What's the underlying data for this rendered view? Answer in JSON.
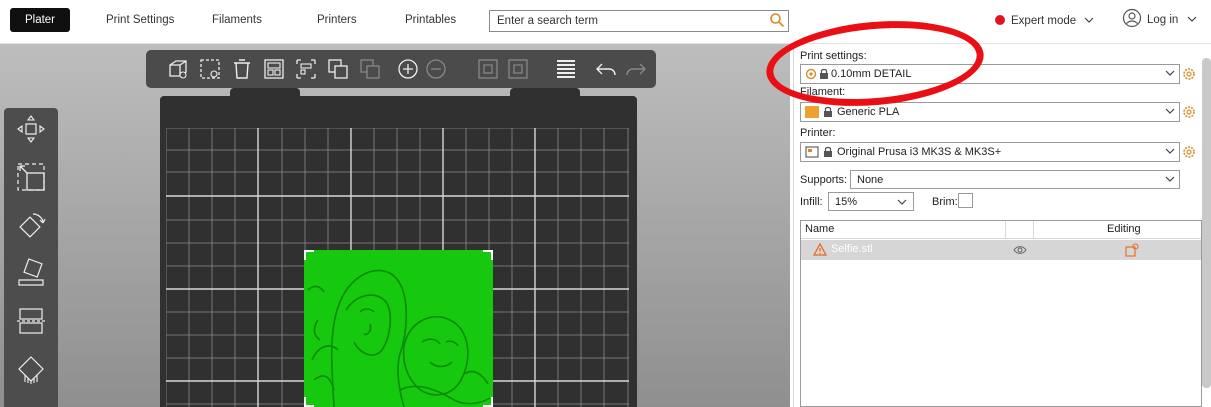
{
  "topbar": {
    "tabs": [
      "Plater",
      "Print Settings",
      "Filaments",
      "Printers",
      "Printables"
    ],
    "active_tab": "Plater",
    "search_placeholder": "Enter a search term",
    "expert_mode_label": "Expert mode",
    "login_label": "Log in"
  },
  "viewport": {
    "toolbar_icons": [
      "add-object-icon",
      "delete-icon",
      "delete-all-icon",
      "arrange-icon",
      "copy-icon",
      "paste-icon",
      "add-instance-icon",
      "remove-instance-icon",
      "split-objects-icon",
      "split-parts-icon",
      "layers-editing-icon",
      "undo-icon",
      "redo-icon"
    ],
    "left_tools": [
      "move-icon",
      "scale-icon",
      "rotate-icon",
      "place-on-face-icon",
      "cut-icon",
      "paint-supports-icon"
    ],
    "model_color": "#16c90f"
  },
  "sidebar": {
    "print_settings_label": "Print settings:",
    "print_settings_value": "0.10mm DETAIL",
    "filament_label": "Filament:",
    "filament_value": "Generic PLA",
    "filament_color": "#f0a030",
    "printer_label": "Printer:",
    "printer_value": "Original Prusa i3 MK3S & MK3S+",
    "supports_label": "Supports:",
    "supports_value": "None",
    "infill_label": "Infill:",
    "infill_value": "15%",
    "brim_label": "Brim:",
    "brim_checked": false,
    "object_list": {
      "col_name": "Name",
      "col_editing": "Editing",
      "rows": [
        {
          "name": "Selfie.stl"
        }
      ]
    }
  },
  "colors": {
    "accent": "#16c90f",
    "annotation": "#ea0f14",
    "expert_dot": "#e01522"
  }
}
